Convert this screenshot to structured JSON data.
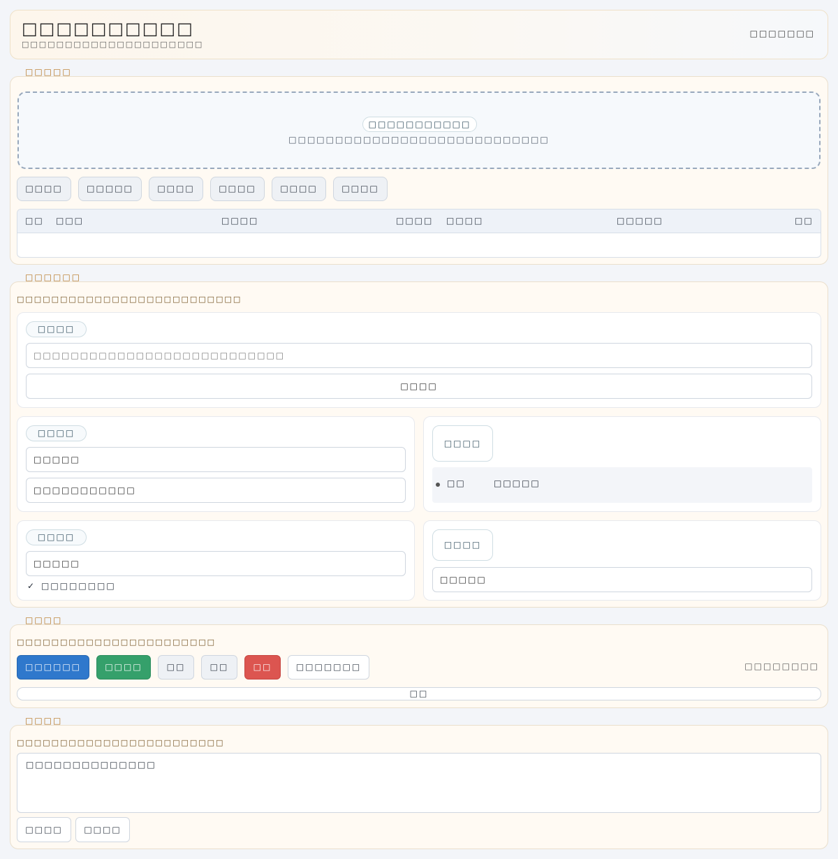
{
  "header": {
    "title": "□□□□□□□□□□",
    "subtitle": "□□□□□□□□□□□□□□□□□□□□□",
    "right_text": "□□□□□□□"
  },
  "section1": {
    "label": "□□□□□",
    "dropzone": {
      "pill": "□□□□□□□□□□□",
      "hint": "□□□□□□□□□□□□□□□□□□□□□□□□□□□□"
    },
    "buttons": [
      "□□□□",
      "□□□□□",
      "□□□□",
      "□□□□",
      "□□□□",
      "□□□□"
    ],
    "table_columns": [
      "□□",
      "□□□",
      "□□□□",
      "□□□□",
      "□□□□",
      "□□□□□",
      "□□"
    ]
  },
  "section2": {
    "label": "□□□□□□",
    "hint": "□□□□□□□□□□□□□□□□□□□□□□□□□□",
    "card_full": {
      "tag": "□□□□",
      "input_placeholder": "□□□□□□□□□□□□□□□□□□□□□□□□□□□",
      "button": "□□□□"
    },
    "card_a": {
      "tag": "□□□□",
      "field1": "□□□□□",
      "field2": "□□□□□□□□□□□"
    },
    "card_b": {
      "tag": "□□□□",
      "radio_label": "□□",
      "radio_value": "□□□□□"
    },
    "card_c": {
      "tag": "□□□□",
      "field1": "□□□□□",
      "check_label": "□□□□□□□□"
    },
    "card_d": {
      "tag": "□□□□",
      "field1": "□□□□□"
    }
  },
  "section3": {
    "label": "□□□□",
    "hint": "□□□□□□□□□□□□□□□□□□□□□□□",
    "buttons": {
      "primary": "□□□□□□",
      "success": "□□□□",
      "grey1": "□□",
      "grey2": "□□",
      "danger": "□□",
      "outline": "□□□□□□□"
    },
    "right_text": "□□□□□□□□",
    "wide_button": "□□"
  },
  "section4": {
    "label": "□□□□",
    "hint": "□□□□□□□□□□□□□□□□□□□□□□□□",
    "textarea_value": "□□□□□□□□□□□□□□",
    "buttons": [
      "□□□□",
      "□□□□"
    ]
  },
  "colors": {
    "accent_blue": "#2f78cc",
    "success_green": "#35a06b",
    "danger_red": "#dc5550",
    "section_label": "#b5731c",
    "panel_bg": "#fffaf3"
  }
}
